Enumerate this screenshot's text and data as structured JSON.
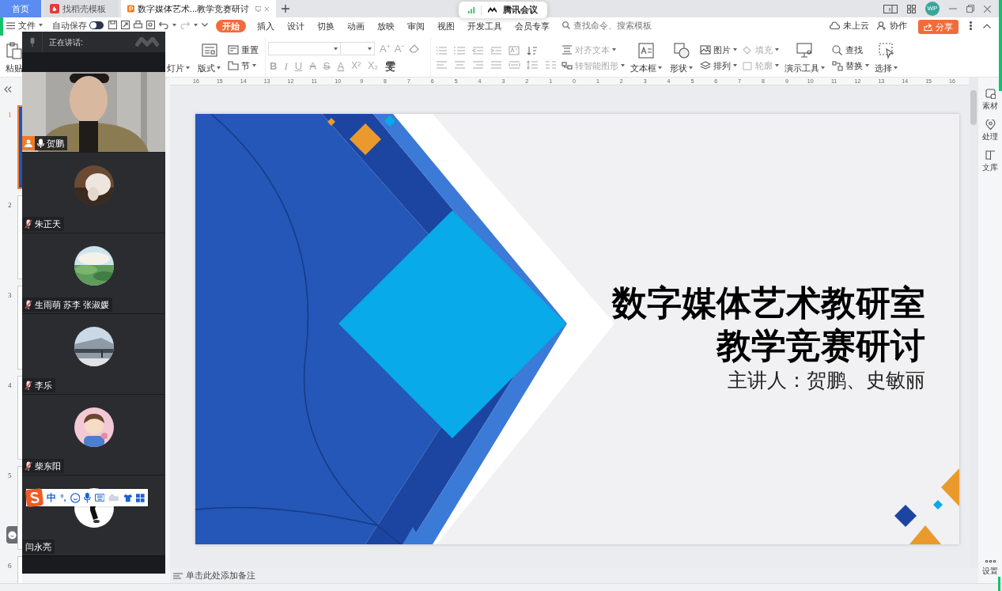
{
  "tabs": [
    {
      "label": "首页",
      "kind": "home",
      "selected": false
    },
    {
      "label": "找稻壳模板",
      "kind": "templates",
      "selected": false
    },
    {
      "label": "数字媒体艺术...教学竞赛研讨",
      "kind": "document",
      "selected": true
    }
  ],
  "account": {
    "initials": "WP"
  },
  "meeting": {
    "title": "腾讯会议"
  },
  "menu": {
    "file": "文件",
    "autosave": "自动保存",
    "autosave_on": false
  },
  "ribbon_tabs": [
    {
      "label": "开始",
      "selected": true
    },
    {
      "label": "插入",
      "selected": false
    },
    {
      "label": "设计",
      "selected": false
    },
    {
      "label": "切换",
      "selected": false
    },
    {
      "label": "动画",
      "selected": false
    },
    {
      "label": "放映",
      "selected": false
    },
    {
      "label": "审阅",
      "selected": false
    },
    {
      "label": "视图",
      "selected": false
    },
    {
      "label": "开发工具",
      "selected": false
    },
    {
      "label": "会员专享",
      "selected": false
    }
  ],
  "search": {
    "placeholder": "查找命令、搜索模板"
  },
  "cloud": "未上云",
  "collab": "协作",
  "share": "分享",
  "ribbon": [
    {
      "kind": "large",
      "items": [
        {
          "label": "粘贴",
          "kind": "paste",
          "dropdown": false,
          "disabled": false
        }
      ]
    },
    {
      "kind": "gap"
    },
    {
      "kind": "large",
      "items": [
        {
          "label": "灯片",
          "kind": "slide",
          "dropdown": true,
          "disabled": false
        }
      ]
    },
    {
      "kind": "large",
      "items": [
        {
          "label": "版式",
          "kind": "layout",
          "dropdown": true,
          "disabled": false
        }
      ]
    },
    {
      "kind": "stack",
      "items": [
        {
          "label": "重置",
          "kind": "reset",
          "dropdown": false,
          "disabled": false
        },
        {
          "label": "节",
          "kind": "section",
          "dropdown": true,
          "disabled": false
        }
      ]
    },
    {
      "kind": "font",
      "disabled": true,
      "sizers": [
        "A⁺",
        "A⁻"
      ],
      "format": [
        {
          "label": "B",
          "kind": "bold"
        },
        {
          "label": "I",
          "kind": "italic"
        },
        {
          "label": "U",
          "kind": "underline"
        },
        {
          "label": "A",
          "kind": "strike"
        },
        {
          "label": "S",
          "kind": "double"
        },
        {
          "label": "A",
          "kind": "color"
        },
        {
          "label": "X²",
          "kind": "plain"
        },
        {
          "label": "X₂",
          "kind": "plain"
        },
        {
          "label": "雯",
          "kind": "phonetic"
        }
      ]
    },
    {
      "kind": "paragraph"
    },
    {
      "kind": "stack",
      "items": [
        {
          "label": "对齐文本",
          "kind": "align",
          "dropdown": true,
          "disabled": true
        },
        {
          "label": "转智能图形",
          "kind": "smartart",
          "dropdown": true,
          "disabled": true
        }
      ]
    },
    {
      "kind": "large",
      "items": [
        {
          "label": "文本框",
          "kind": "textbox",
          "dropdown": true,
          "disabled": false
        }
      ]
    },
    {
      "kind": "large",
      "items": [
        {
          "label": "形状",
          "kind": "shapes",
          "dropdown": true,
          "disabled": false
        }
      ]
    },
    {
      "kind": "stack",
      "items": [
        {
          "label": "图片",
          "kind": "picture",
          "dropdown": true,
          "disabled": false
        },
        {
          "label": "排列",
          "kind": "arrange",
          "dropdown": true,
          "disabled": false
        }
      ]
    },
    {
      "kind": "stack",
      "items": [
        {
          "label": "填充",
          "kind": "fill",
          "dropdown": true,
          "disabled": true
        },
        {
          "label": "轮廓",
          "kind": "outline",
          "dropdown": true,
          "disabled": true
        }
      ]
    },
    {
      "kind": "large",
      "items": [
        {
          "label": "演示工具",
          "kind": "presenter",
          "dropdown": true,
          "disabled": false
        }
      ]
    },
    {
      "kind": "stack",
      "items": [
        {
          "label": "查找",
          "kind": "find",
          "dropdown": false,
          "disabled": false
        },
        {
          "label": "替换",
          "kind": "replace",
          "dropdown": true,
          "disabled": false
        }
      ]
    },
    {
      "kind": "large",
      "items": [
        {
          "label": "选择",
          "kind": "select",
          "dropdown": true,
          "disabled": false
        }
      ]
    }
  ],
  "thumbnails": [
    {
      "number": "1",
      "selected": true
    },
    {
      "number": "2",
      "selected": false
    },
    {
      "number": "3",
      "selected": false
    },
    {
      "number": "4",
      "selected": false
    },
    {
      "number": "5",
      "selected": false
    },
    {
      "number": "6",
      "selected": false
    }
  ],
  "ruler": [
    "16",
    "15",
    "14",
    "13",
    "12",
    "11",
    "10",
    "9",
    "8",
    "7",
    "6",
    "5",
    "4",
    "3",
    "2",
    "1",
    "0",
    "1",
    "2",
    "3",
    "4",
    "5",
    "6",
    "7",
    "8",
    "9",
    "10",
    "11",
    "12",
    "13",
    "14",
    "15",
    "16"
  ],
  "slide": {
    "title": "数字媒体艺术教研室",
    "subtitle": "教学竞赛研讨",
    "presenter": "主讲人：贺鹏、史敏丽"
  },
  "notes": {
    "placeholder": "单击此处添加备注"
  },
  "side_tools": [
    {
      "label": "素材",
      "kind": "material"
    },
    {
      "label": "处理",
      "kind": "process"
    },
    {
      "label": "文库",
      "kind": "library"
    }
  ],
  "settings": "设置",
  "video_panel": {
    "header": "正在讲话:",
    "participants": [
      {
        "name": "贺鹏",
        "kind": "video",
        "muted": false,
        "host": true
      },
      {
        "name": "朱正天",
        "kind": "avatar",
        "muted": true,
        "host": false
      },
      {
        "name": "生雨萌 苏李 张淑媛",
        "kind": "avatar",
        "muted": true,
        "host": false
      },
      {
        "name": "李乐",
        "kind": "avatar",
        "muted": true,
        "host": false
      },
      {
        "name": "柴东阳",
        "kind": "avatar",
        "muted": true,
        "host": false
      },
      {
        "name": "闫永亮",
        "kind": "avatar",
        "host": false
      }
    ]
  },
  "ime": {
    "mode": "中",
    "punctuation": "°,"
  }
}
